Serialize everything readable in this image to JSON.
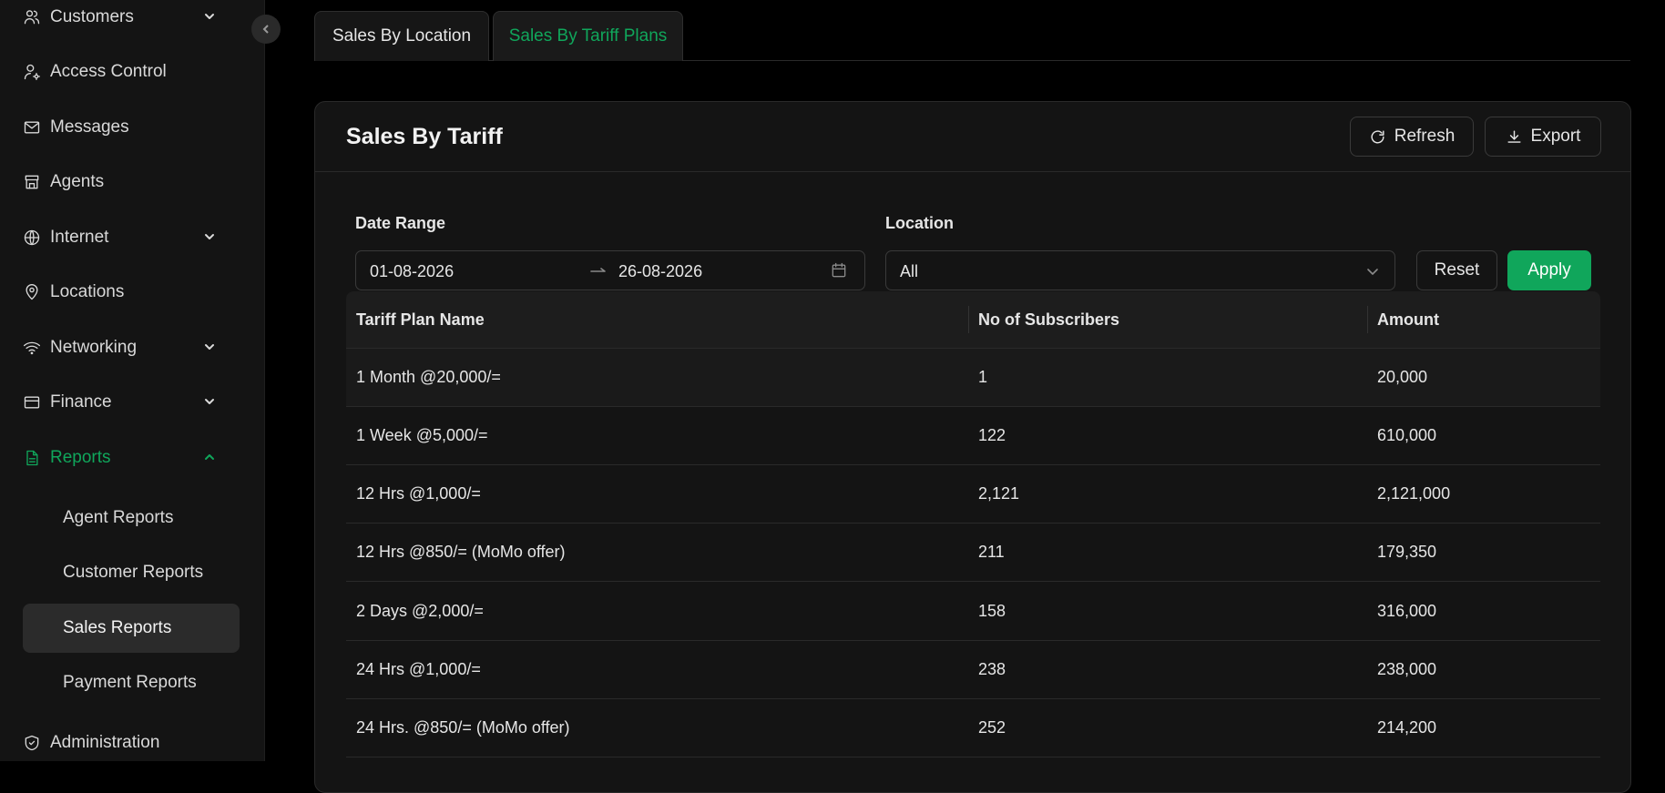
{
  "sidebar": {
    "items": [
      {
        "label": "Customers",
        "icon": "customers-icon"
      },
      {
        "label": "Access Control",
        "icon": "user-icon"
      },
      {
        "label": "Messages",
        "icon": "mail-icon"
      },
      {
        "label": "Agents",
        "icon": "store-icon"
      },
      {
        "label": "Internet",
        "icon": "globe-icon"
      },
      {
        "label": "Locations",
        "icon": "location-pin-icon"
      },
      {
        "label": "Networking",
        "icon": "wifi-icon"
      },
      {
        "label": "Finance",
        "icon": "wallet-icon"
      },
      {
        "label": "Reports",
        "icon": "report-icon"
      },
      {
        "label": "Administration",
        "icon": "shield-icon"
      }
    ],
    "reports_sub": [
      {
        "label": "Agent Reports"
      },
      {
        "label": "Customer Reports"
      },
      {
        "label": "Sales Reports"
      },
      {
        "label": "Payment Reports"
      }
    ],
    "active_color": "#10a65b"
  },
  "tabs": [
    {
      "label": "Sales By Location"
    },
    {
      "label": "Sales By Tariff Plans"
    }
  ],
  "card": {
    "title": "Sales By Tariff",
    "refresh_label": "Refresh",
    "export_label": "Export"
  },
  "filters": {
    "date_range_label": "Date Range",
    "start_date": "01-08-2026",
    "end_date": "26-08-2026",
    "location_label": "Location",
    "location_value": "All",
    "reset_label": "Reset",
    "apply_label": "Apply"
  },
  "table": {
    "headers": [
      "Tariff Plan Name",
      "No of Subscribers",
      "Amount"
    ],
    "rows": [
      [
        "1 Month @20,000/=",
        "1",
        "20,000"
      ],
      [
        "1 Week @5,000/=",
        "122",
        "610,000"
      ],
      [
        "12 Hrs @1,000/=",
        "2,121",
        "2,121,000"
      ],
      [
        "12 Hrs @850/= (MoMo offer)",
        "211",
        "179,350"
      ],
      [
        "2 Days @2,000/=",
        "158",
        "316,000"
      ],
      [
        "24 Hrs @1,000/=",
        "238",
        "238,000"
      ],
      [
        "24 Hrs. @850/= (MoMo offer)",
        "252",
        "214,200"
      ]
    ]
  }
}
